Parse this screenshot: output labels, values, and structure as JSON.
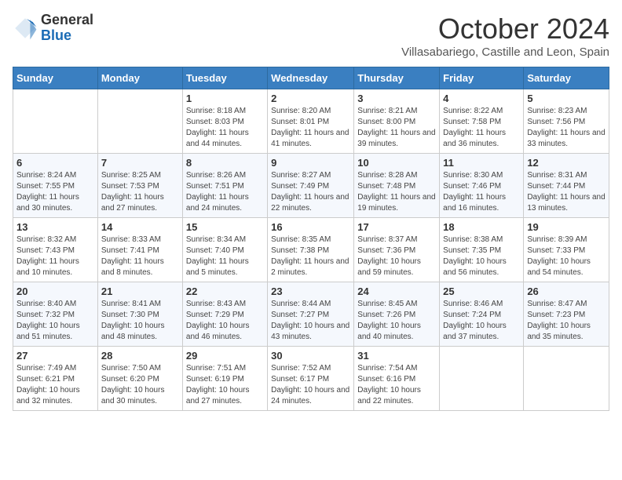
{
  "logo": {
    "general": "General",
    "blue": "Blue"
  },
  "title": "October 2024",
  "subtitle": "Villasabariego, Castille and Leon, Spain",
  "days_header": [
    "Sunday",
    "Monday",
    "Tuesday",
    "Wednesday",
    "Thursday",
    "Friday",
    "Saturday"
  ],
  "weeks": [
    [
      {
        "num": "",
        "detail": ""
      },
      {
        "num": "",
        "detail": ""
      },
      {
        "num": "1",
        "detail": "Sunrise: 8:18 AM\nSunset: 8:03 PM\nDaylight: 11 hours and 44 minutes."
      },
      {
        "num": "2",
        "detail": "Sunrise: 8:20 AM\nSunset: 8:01 PM\nDaylight: 11 hours and 41 minutes."
      },
      {
        "num": "3",
        "detail": "Sunrise: 8:21 AM\nSunset: 8:00 PM\nDaylight: 11 hours and 39 minutes."
      },
      {
        "num": "4",
        "detail": "Sunrise: 8:22 AM\nSunset: 7:58 PM\nDaylight: 11 hours and 36 minutes."
      },
      {
        "num": "5",
        "detail": "Sunrise: 8:23 AM\nSunset: 7:56 PM\nDaylight: 11 hours and 33 minutes."
      }
    ],
    [
      {
        "num": "6",
        "detail": "Sunrise: 8:24 AM\nSunset: 7:55 PM\nDaylight: 11 hours and 30 minutes."
      },
      {
        "num": "7",
        "detail": "Sunrise: 8:25 AM\nSunset: 7:53 PM\nDaylight: 11 hours and 27 minutes."
      },
      {
        "num": "8",
        "detail": "Sunrise: 8:26 AM\nSunset: 7:51 PM\nDaylight: 11 hours and 24 minutes."
      },
      {
        "num": "9",
        "detail": "Sunrise: 8:27 AM\nSunset: 7:49 PM\nDaylight: 11 hours and 22 minutes."
      },
      {
        "num": "10",
        "detail": "Sunrise: 8:28 AM\nSunset: 7:48 PM\nDaylight: 11 hours and 19 minutes."
      },
      {
        "num": "11",
        "detail": "Sunrise: 8:30 AM\nSunset: 7:46 PM\nDaylight: 11 hours and 16 minutes."
      },
      {
        "num": "12",
        "detail": "Sunrise: 8:31 AM\nSunset: 7:44 PM\nDaylight: 11 hours and 13 minutes."
      }
    ],
    [
      {
        "num": "13",
        "detail": "Sunrise: 8:32 AM\nSunset: 7:43 PM\nDaylight: 11 hours and 10 minutes."
      },
      {
        "num": "14",
        "detail": "Sunrise: 8:33 AM\nSunset: 7:41 PM\nDaylight: 11 hours and 8 minutes."
      },
      {
        "num": "15",
        "detail": "Sunrise: 8:34 AM\nSunset: 7:40 PM\nDaylight: 11 hours and 5 minutes."
      },
      {
        "num": "16",
        "detail": "Sunrise: 8:35 AM\nSunset: 7:38 PM\nDaylight: 11 hours and 2 minutes."
      },
      {
        "num": "17",
        "detail": "Sunrise: 8:37 AM\nSunset: 7:36 PM\nDaylight: 10 hours and 59 minutes."
      },
      {
        "num": "18",
        "detail": "Sunrise: 8:38 AM\nSunset: 7:35 PM\nDaylight: 10 hours and 56 minutes."
      },
      {
        "num": "19",
        "detail": "Sunrise: 8:39 AM\nSunset: 7:33 PM\nDaylight: 10 hours and 54 minutes."
      }
    ],
    [
      {
        "num": "20",
        "detail": "Sunrise: 8:40 AM\nSunset: 7:32 PM\nDaylight: 10 hours and 51 minutes."
      },
      {
        "num": "21",
        "detail": "Sunrise: 8:41 AM\nSunset: 7:30 PM\nDaylight: 10 hours and 48 minutes."
      },
      {
        "num": "22",
        "detail": "Sunrise: 8:43 AM\nSunset: 7:29 PM\nDaylight: 10 hours and 46 minutes."
      },
      {
        "num": "23",
        "detail": "Sunrise: 8:44 AM\nSunset: 7:27 PM\nDaylight: 10 hours and 43 minutes."
      },
      {
        "num": "24",
        "detail": "Sunrise: 8:45 AM\nSunset: 7:26 PM\nDaylight: 10 hours and 40 minutes."
      },
      {
        "num": "25",
        "detail": "Sunrise: 8:46 AM\nSunset: 7:24 PM\nDaylight: 10 hours and 37 minutes."
      },
      {
        "num": "26",
        "detail": "Sunrise: 8:47 AM\nSunset: 7:23 PM\nDaylight: 10 hours and 35 minutes."
      }
    ],
    [
      {
        "num": "27",
        "detail": "Sunrise: 7:49 AM\nSunset: 6:21 PM\nDaylight: 10 hours and 32 minutes."
      },
      {
        "num": "28",
        "detail": "Sunrise: 7:50 AM\nSunset: 6:20 PM\nDaylight: 10 hours and 30 minutes."
      },
      {
        "num": "29",
        "detail": "Sunrise: 7:51 AM\nSunset: 6:19 PM\nDaylight: 10 hours and 27 minutes."
      },
      {
        "num": "30",
        "detail": "Sunrise: 7:52 AM\nSunset: 6:17 PM\nDaylight: 10 hours and 24 minutes."
      },
      {
        "num": "31",
        "detail": "Sunrise: 7:54 AM\nSunset: 6:16 PM\nDaylight: 10 hours and 22 minutes."
      },
      {
        "num": "",
        "detail": ""
      },
      {
        "num": "",
        "detail": ""
      }
    ]
  ]
}
